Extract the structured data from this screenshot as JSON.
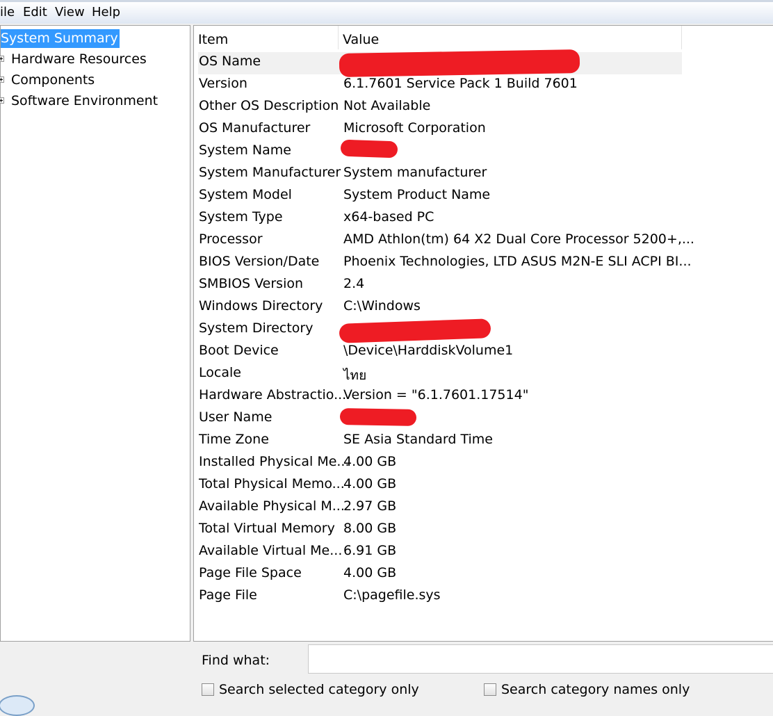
{
  "menu": [
    "ile",
    "Edit",
    "View",
    "Help"
  ],
  "tree": {
    "root": "System Summary",
    "nodes": [
      "Hardware Resources",
      "Components",
      "Software Environment"
    ]
  },
  "list": {
    "headers": {
      "item": "Item",
      "value": "Value"
    },
    "rows": [
      {
        "item": "OS Name",
        "value": ""
      },
      {
        "item": "Version",
        "value": "6.1.7601 Service Pack 1 Build 7601"
      },
      {
        "item": "Other OS Description",
        "value": "Not Available"
      },
      {
        "item": "OS Manufacturer",
        "value": "Microsoft Corporation"
      },
      {
        "item": "System Name",
        "value": ""
      },
      {
        "item": "System Manufacturer",
        "value": "System manufacturer"
      },
      {
        "item": "System Model",
        "value": "System Product Name"
      },
      {
        "item": "System Type",
        "value": "x64-based PC"
      },
      {
        "item": "Processor",
        "value": "AMD Athlon(tm) 64 X2 Dual Core Processor 5200+,..."
      },
      {
        "item": "BIOS Version/Date",
        "value": "Phoenix Technologies, LTD ASUS M2N-E SLI ACPI BI..."
      },
      {
        "item": "SMBIOS Version",
        "value": "2.4"
      },
      {
        "item": "Windows Directory",
        "value": "C:\\Windows"
      },
      {
        "item": "System Directory",
        "value": ""
      },
      {
        "item": "Boot Device",
        "value": "\\Device\\HarddiskVolume1"
      },
      {
        "item": "Locale",
        "value": "ไทย"
      },
      {
        "item": "Hardware Abstractio...",
        "value": "Version = \"6.1.7601.17514\""
      },
      {
        "item": "User Name",
        "value": ""
      },
      {
        "item": "Time Zone",
        "value": "SE Asia Standard Time"
      },
      {
        "item": "Installed Physical Me...",
        "value": "4.00 GB"
      },
      {
        "item": "Total Physical Memo...",
        "value": "4.00 GB"
      },
      {
        "item": "Available Physical M...",
        "value": "2.97 GB"
      },
      {
        "item": "Total Virtual Memory",
        "value": "8.00 GB"
      },
      {
        "item": "Available Virtual Me...",
        "value": "6.91 GB"
      },
      {
        "item": "Page File Space",
        "value": "4.00 GB"
      },
      {
        "item": "Page File",
        "value": "C:\\pagefile.sys"
      }
    ]
  },
  "find": {
    "label": "Find what:",
    "value": "",
    "checkbox_selected_category": "Search selected category only",
    "checkbox_category_names": "Search category names only"
  },
  "colors": {
    "selection": "#3399ff",
    "redaction": "#ee1c24"
  }
}
